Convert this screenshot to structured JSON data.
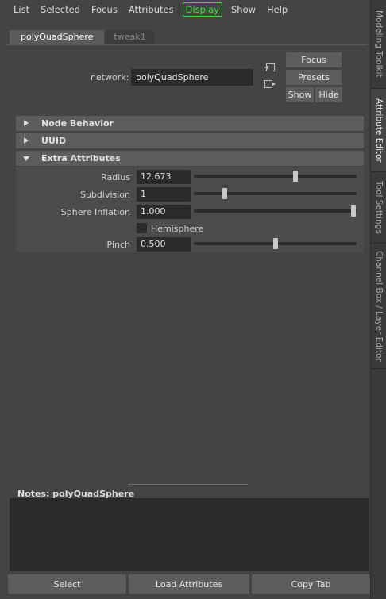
{
  "menu": [
    "List",
    "Selected",
    "Focus",
    "Attributes",
    "Display",
    "Show",
    "Help"
  ],
  "side_tabs": [
    "Modeling Toolkit",
    "Attribute Editor",
    "Tool Settings",
    "Channel Box / Layer Editor"
  ],
  "tabs": [
    "polyQuadSphere",
    "tweak1"
  ],
  "network": {
    "label": "network:",
    "value": "polyQuadSphere"
  },
  "buttons": {
    "focus": "Focus",
    "presets": "Presets",
    "show": "Show",
    "hide": "Hide"
  },
  "sections": [
    "Node Behavior",
    "UUID",
    "Extra Attributes"
  ],
  "attributes": [
    {
      "label": "Radius",
      "value": "12.673",
      "slider": 0.63
    },
    {
      "label": "Subdivision",
      "value": "1",
      "slider": 0.18
    },
    {
      "label": "Sphere Inflation",
      "value": "1.000",
      "slider": 0.995
    },
    {
      "label": "Pinch",
      "value": "0.500",
      "slider": 0.5
    }
  ],
  "hemisphere": {
    "label": "Hemisphere",
    "checked": false
  },
  "notes": {
    "label": "Notes:  polyQuadSphere"
  },
  "bottom_buttons": [
    "Select",
    "Load Attributes",
    "Copy Tab"
  ],
  "colors": {
    "highlight": "#3ee03e",
    "panel": "#444444",
    "field": "#2b2b2b",
    "button": "#5d5d5d"
  }
}
